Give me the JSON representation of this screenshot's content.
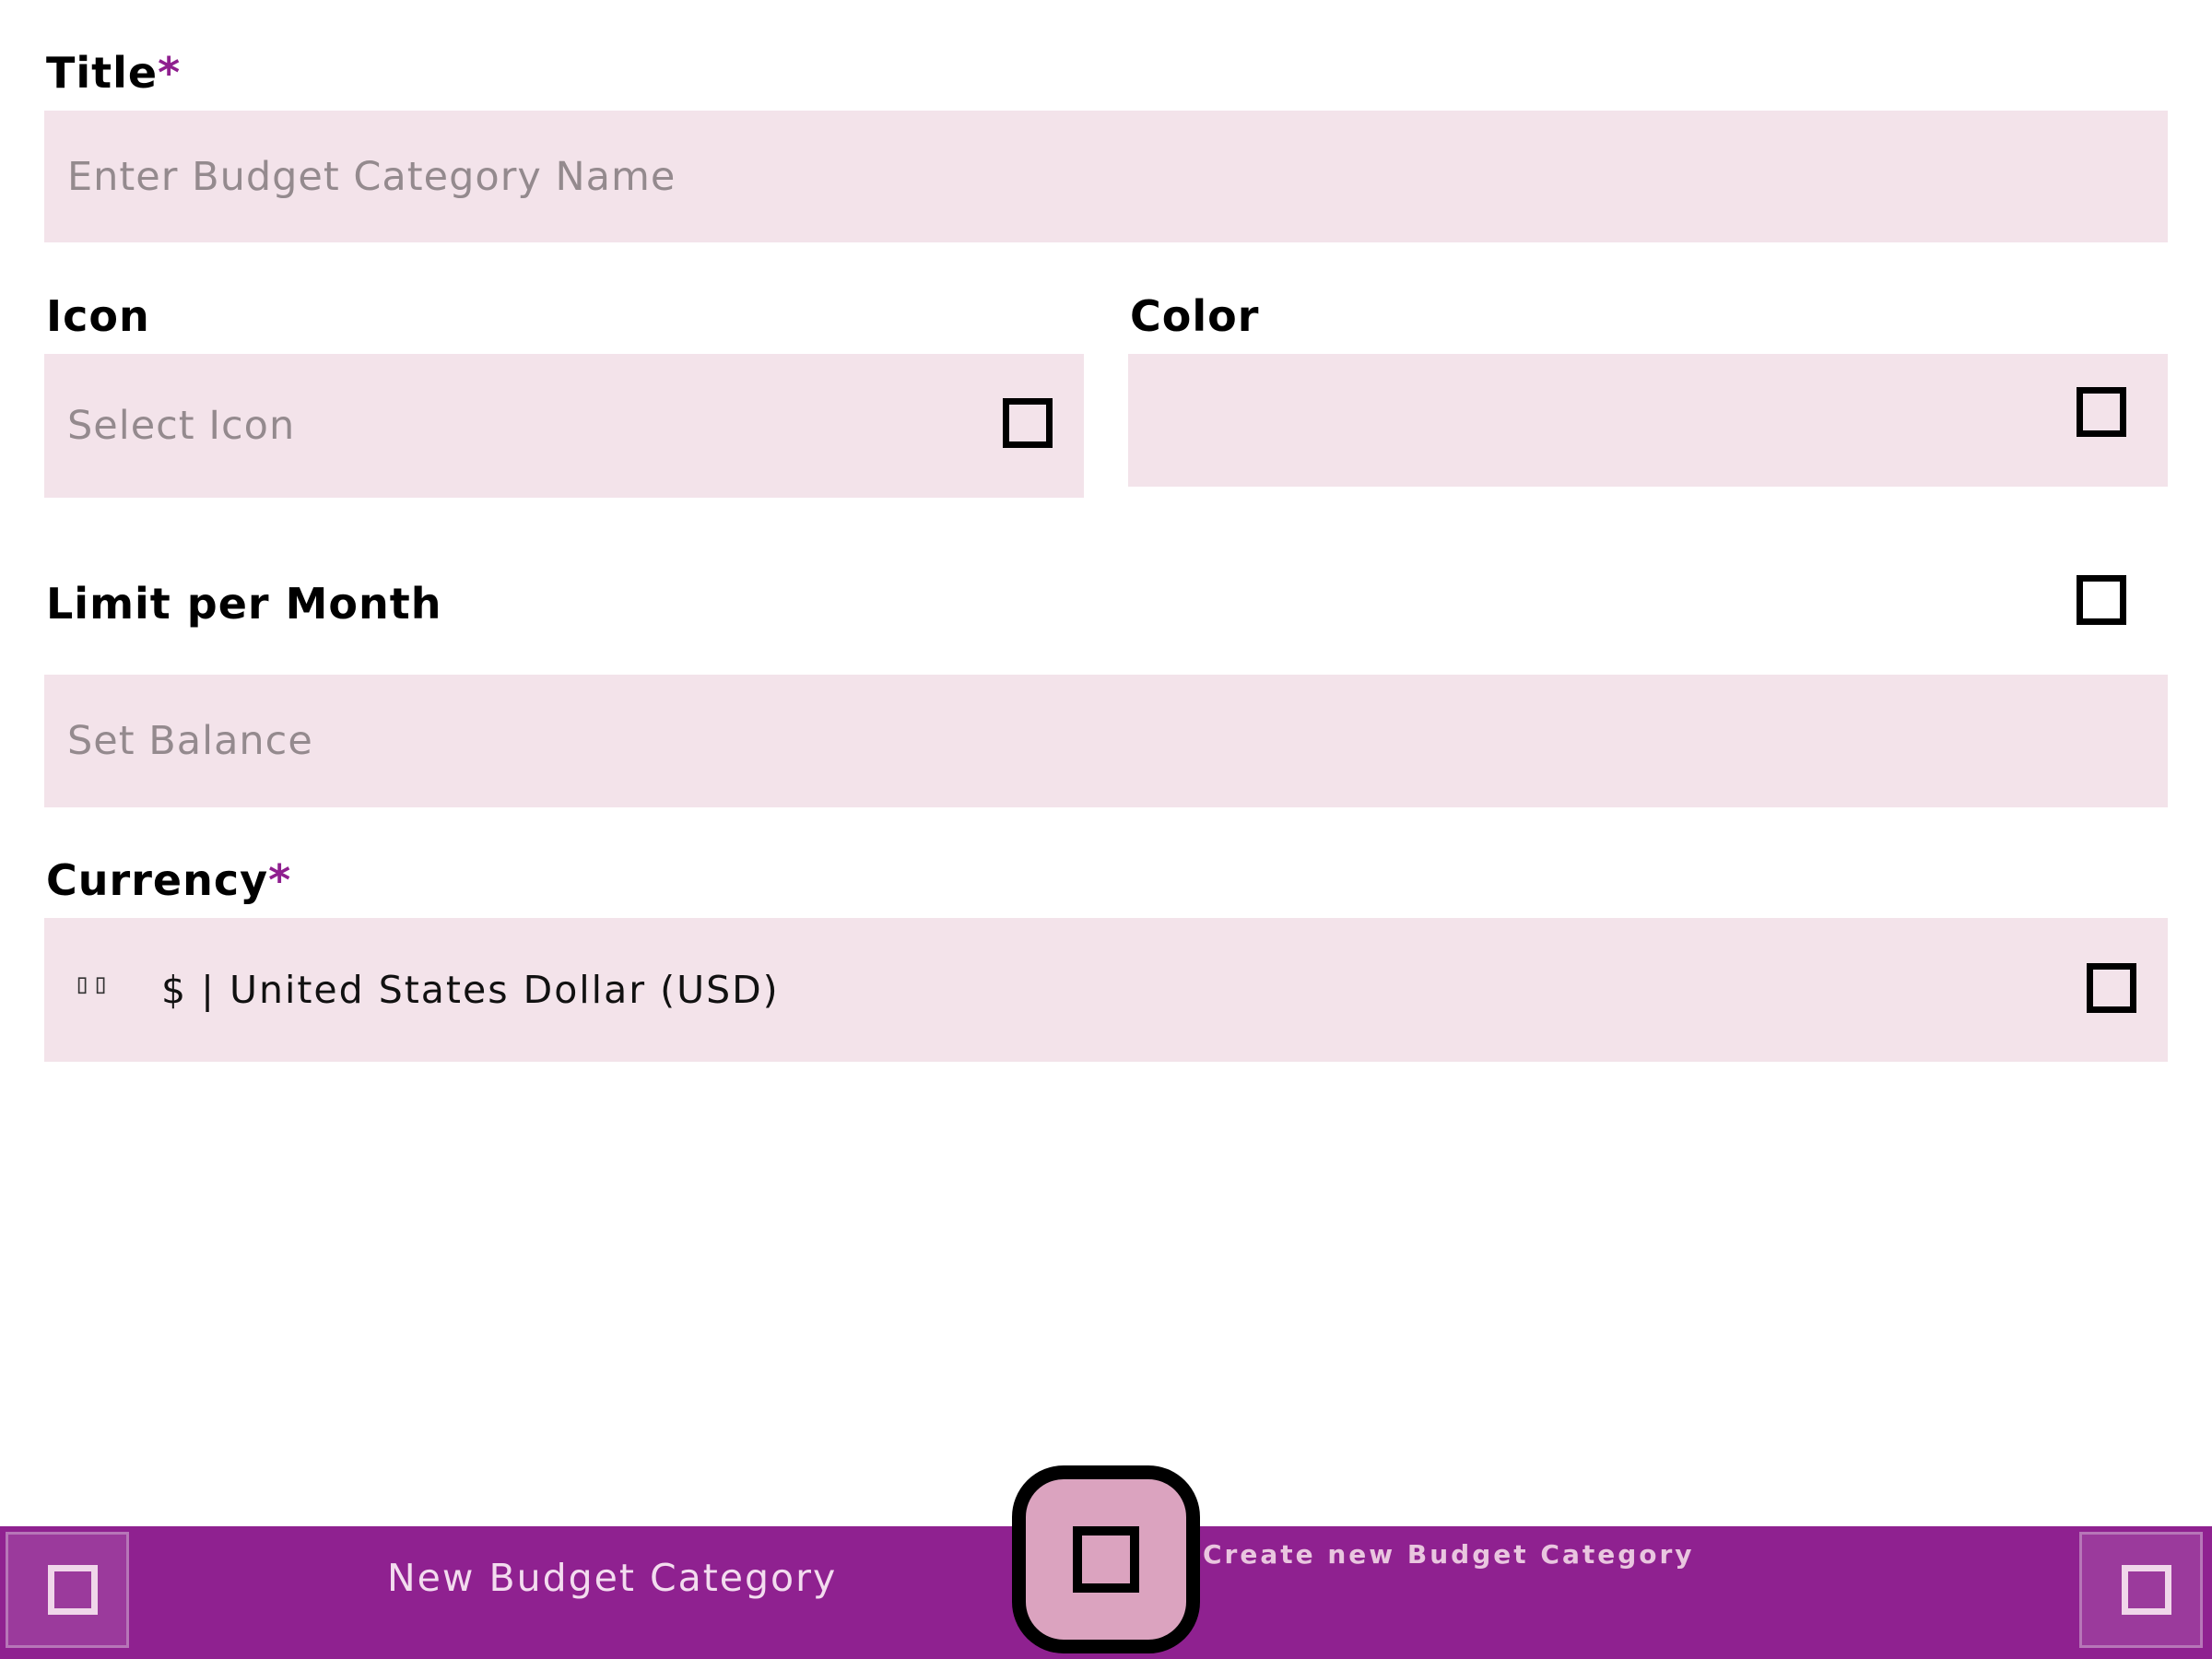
{
  "form": {
    "title": {
      "label": "Title",
      "required_mark": "*",
      "placeholder": "Enter Budget Category Name"
    },
    "icon": {
      "label": "Icon",
      "placeholder": "Select Icon",
      "trailing_icon": "square-icon"
    },
    "color": {
      "label": "Color",
      "value": "",
      "trailing_icon": "square-icon"
    },
    "limit": {
      "label": "Limit per Month",
      "toggle_icon": "checkbox-icon",
      "placeholder": "Set Balance"
    },
    "currency": {
      "label": "Currency",
      "required_mark": "*",
      "flag": "▯▯",
      "value": "$ | United States Dollar (USD)",
      "trailing_icon": "square-icon"
    }
  },
  "bottom_bar": {
    "title": "New Budget Category",
    "left_button_icon": "square-icon",
    "right_button_icon": "square-icon",
    "fab_icon": "square-icon",
    "fab_tooltip": "Create new Budget Category"
  },
  "colors": {
    "accent": "#8f2190",
    "field_background": "#f3e3ea",
    "fab_background": "#dba3bf",
    "required_mark": "#8f1f8f"
  }
}
